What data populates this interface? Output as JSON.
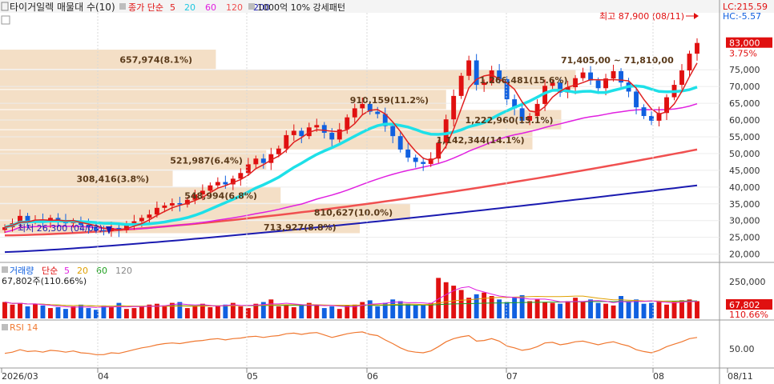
{
  "header": {
    "title": "타이거일렉 매물대 수(10)",
    "ma_label": "종가 단순",
    "ma_periods": [
      {
        "label": "5",
        "color": "#e02020"
      },
      {
        "label": "20",
        "color": "#1ec8e0"
      },
      {
        "label": "60",
        "color": "#e020e0"
      },
      {
        "label": "120",
        "color": "#f05050"
      },
      {
        "label": "200",
        "color": "#1a1ab0"
      }
    ],
    "pattern_label": "1000억 10% 강세패턴"
  },
  "price_panel": {
    "lc": "LC:215.59",
    "hc": "HC:-5.57",
    "current_price": "83,000",
    "change_pct": "3.75%",
    "high_annotation": "최고 87,900 (08/11)",
    "low_annotation": "최저 26,300 (04/03)",
    "y_ticks": [
      "75,000",
      "70,000",
      "65,000",
      "60,000",
      "55,000",
      "50,000",
      "45,000",
      "40,000",
      "35,000",
      "30,000",
      "25,000",
      "20,000"
    ],
    "volume_profile": [
      {
        "label": "657,974(8.1%)",
        "lo": 75000,
        "hi": 81000,
        "w": 0.3
      },
      {
        "label": "1,266,481(15.6%)",
        "lo": 69000,
        "hi": 75000,
        "w": 0.8
      },
      {
        "label": "910,159(11.2%)",
        "lo": 63000,
        "hi": 69000,
        "w": 0.62
      },
      {
        "label": "1,222,960(15.1%)",
        "lo": 57000,
        "hi": 63000,
        "w": 0.78
      },
      {
        "label": "1,142,344(14.1%)",
        "lo": 51000,
        "hi": 57000,
        "w": 0.74
      },
      {
        "label": "521,987(6.4%)",
        "lo": 45000,
        "hi": 51000,
        "w": 0.37
      },
      {
        "label": "308,416(3.8%)",
        "lo": 40000,
        "hi": 45000,
        "w": 0.24
      },
      {
        "label": "548,994(6.8%)",
        "lo": 35000,
        "hi": 40000,
        "w": 0.39
      },
      {
        "label": "810,627(10.0%)",
        "lo": 30000,
        "hi": 35000,
        "w": 0.57
      },
      {
        "label": "713,927(8.8%)",
        "lo": 26000,
        "hi": 30000,
        "w": 0.5
      }
    ],
    "range_annotation": "71,405,00 ~ 71,810,00"
  },
  "volume_panel": {
    "title": "거래량",
    "ma_label": "단순",
    "ma_periods": [
      {
        "label": "5",
        "color": "#e020e0"
      },
      {
        "label": "20",
        "color": "#e0a000"
      },
      {
        "label": "60",
        "color": "#20a020"
      },
      {
        "label": "120",
        "color": "#888888"
      }
    ],
    "current_volume": "67,802주(110.66%)",
    "y_tick": "250,000",
    "value_badge": "67,802",
    "pct_badge": "110.66%"
  },
  "rsi_panel": {
    "title": "RSI 14",
    "y_tick": "50.00"
  },
  "x_axis": {
    "labels": [
      "2026/03",
      "04",
      "05",
      "06",
      "07",
      "08",
      "08/11"
    ]
  },
  "chart_data": {
    "type": "candlestick",
    "ylim": [
      18000,
      92000
    ],
    "high": {
      "value": 87900,
      "date": "08/11"
    },
    "low": {
      "value": 26300,
      "date": "04/03"
    },
    "last_close": 83000,
    "close_series": [
      28000,
      29200,
      31400,
      29800,
      30200,
      29500,
      30800,
      30100,
      29200,
      29800,
      28700,
      28200,
      27100,
      26900,
      27800,
      27200,
      28500,
      29800,
      30800,
      31800,
      33800,
      34500,
      35200,
      34800,
      36200,
      37800,
      38900,
      40500,
      41500,
      40800,
      42500,
      44200,
      46800,
      48500,
      47200,
      49800,
      51500,
      55500,
      56800,
      55200,
      57800,
      58500,
      56200,
      54200,
      57200,
      60800,
      63500,
      64800,
      62500,
      61800,
      58200,
      55200,
      51200,
      48800,
      47500,
      46900,
      48500,
      53200,
      60200,
      67200,
      73200,
      77800,
      70500,
      71200,
      74800,
      72200,
      66200,
      63500,
      59800,
      61200,
      64800,
      70200,
      71200,
      68200,
      69800,
      72500,
      74200,
      71800,
      69500,
      72400,
      74600,
      71200,
      68500,
      63800,
      61200,
      59800,
      62100,
      66800,
      70500,
      74800,
      79800,
      83000
    ],
    "volume_series": [
      95,
      80,
      90,
      70,
      85,
      75,
      60,
      65,
      55,
      70,
      80,
      60,
      50,
      75,
      65,
      90,
      55,
      60,
      70,
      80,
      85,
      75,
      90,
      95,
      60,
      70,
      85,
      65,
      75,
      80,
      90,
      70,
      60,
      85,
      95,
      110,
      70,
      80,
      65,
      75,
      90,
      80,
      60,
      70,
      55,
      75,
      80,
      95,
      105,
      70,
      90,
      110,
      100,
      85,
      75,
      80,
      90,
      235,
      210,
      190,
      165,
      120,
      140,
      150,
      130,
      110,
      95,
      120,
      135,
      100,
      110,
      95,
      90,
      85,
      100,
      120,
      95,
      110,
      90,
      85,
      75,
      130,
      95,
      110,
      85,
      90,
      100,
      80,
      95,
      105,
      110,
      100
    ],
    "rsi_series": [
      46,
      48,
      52,
      49,
      50,
      48,
      51,
      50,
      48,
      50,
      47,
      46,
      44,
      44,
      47,
      46,
      49,
      52,
      55,
      57,
      60,
      62,
      63,
      62,
      64,
      66,
      67,
      69,
      70,
      68,
      70,
      71,
      73,
      74,
      72,
      74,
      75,
      78,
      79,
      77,
      79,
      80,
      76,
      72,
      75,
      78,
      80,
      81,
      77,
      75,
      68,
      62,
      55,
      50,
      48,
      47,
      50,
      57,
      65,
      70,
      73,
      75,
      66,
      67,
      70,
      66,
      58,
      55,
      51,
      53,
      57,
      63,
      64,
      60,
      62,
      65,
      66,
      63,
      60,
      63,
      65,
      61,
      58,
      52,
      49,
      47,
      51,
      57,
      61,
      65,
      70,
      72
    ]
  }
}
